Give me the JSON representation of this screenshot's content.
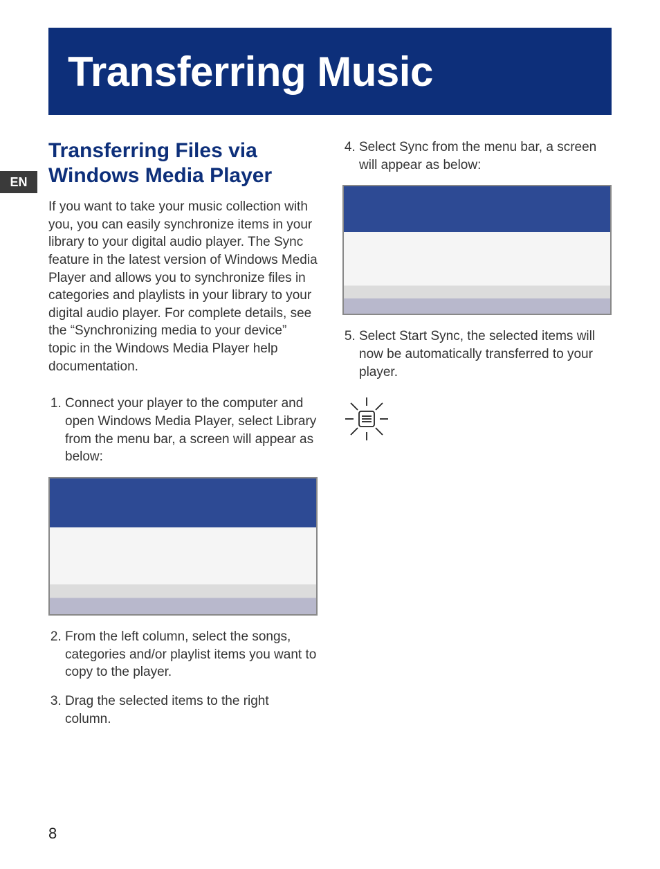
{
  "lang_tab": "EN",
  "banner": {
    "title": "Transferring Music"
  },
  "left": {
    "heading": "Transferring Files via Windows Media Player",
    "intro": "If you want to take your music collection with you, you can easily synchronize items in your library to your digital audio player. The Sync feature in the latest version of Windows Media Player and allows you to synchronize files in categories and playlists in your library to your digital audio player.  For complete details, see the “Synchronizing media to your device” topic in the Windows Media Player help documentation.",
    "step1": "Connect your player to the computer and open Windows Media Player, select Library from the menu bar, a screen will appear as below:",
    "step2": "From the left column, select the songs, categories and/or playlist items you want to copy to the player.",
    "step3": "Drag the selected items to the right column."
  },
  "right": {
    "step4": "Select Sync from the menu bar, a screen will appear as below:",
    "step5": "Select Start Sync, the selected items will now be automatically transferred to your player."
  },
  "page_number": "8"
}
